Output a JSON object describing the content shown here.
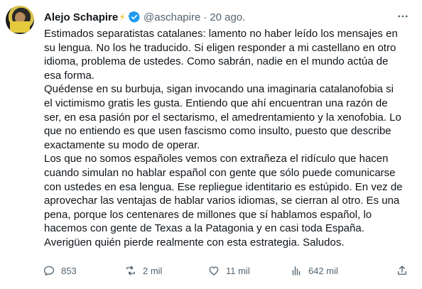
{
  "author": {
    "name": "Alejo Schapire",
    "emoji": "⚡",
    "handle": "@aschapire",
    "separator": "·",
    "date": "20 ago."
  },
  "tweet_lines": [
    "Estimados separatistas catalanes: lamento no haber leído los mensajes en",
    "su lengua. No los he traducido. Si eligen responder a mi castellano en otro",
    "idioma, problema de ustedes.  Como sabrán, nadie en el mundo actúa de",
    "esa forma.",
    "Quédense en su burbuja, sigan invocando una imaginaria catalanofobia si",
    "el victimismo gratis les gusta. Entiendo que ahí encuentran una razón de",
    "ser, en esa pasión por el sectarismo, el amedrentamiento y la xenofobia. Lo",
    "que no entiendo es que usen fascismo como insulto, puesto que describe",
    "exactamente su modo de operar.",
    "Los que no somos españoles vemos con extrañeza el ridículo que hacen",
    "cuando simulan no hablar español con gente que sólo puede comunicarse",
    "con ustedes en esa lengua. Ese repliegue identitario es estúpido. En vez de",
    "aprovechar las ventajas de hablar varios idiomas, se cierran al otro. Es una",
    "pena, porque los centenares de millones que sí hablamos español, lo",
    "hacemos con gente de Texas a la Patagonia y en casi toda España.",
    "Averigüen quién pierde realmente con esta estrategia. Saludos."
  ],
  "actions": {
    "replies": "853",
    "retweets": "2 mil",
    "likes": "11 mil",
    "views": "642 mil"
  },
  "icons": {
    "verified": "verified-badge-icon",
    "more": "more-icon",
    "reply": "reply-icon",
    "retweet": "retweet-icon",
    "like": "heart-icon",
    "views": "views-icon",
    "share": "share-icon"
  },
  "colors": {
    "text": "#0f1419",
    "secondary": "#536471",
    "verified": "#1d9bf0",
    "bolt": "#f4b400"
  }
}
